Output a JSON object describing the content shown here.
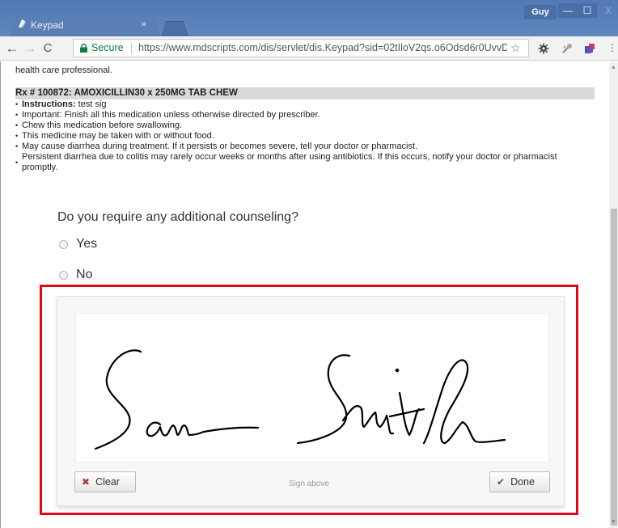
{
  "browser": {
    "tab_title": "Keypad",
    "tab_close": "×",
    "profile": "Guy",
    "window_minimize": "—",
    "window_maximize": "☐",
    "window_close": "X",
    "secure_label": "Secure",
    "url": "https://www.mdscripts.com/dis/servlet/dis.Keypad?sid=02tIloV2qs.o6Odsd6r0UvvD",
    "back_icon": "←",
    "forward_icon": "→",
    "reload_icon": "C",
    "star_icon": "☆"
  },
  "page": {
    "hcp_text": "health care professional.",
    "rx_header": "Rx # 100872: AMOXICILLIN30 x 250MG TAB CHEW",
    "instructions_label": "Instructions:",
    "instructions_value": " test sig",
    "notes": [
      "Important: Finish all this medication unless otherwise directed by prescriber.",
      "Chew this medication before swallowing.",
      "This medicine may be taken with or without food.",
      "May cause diarrhea during treatment. If it persists or becomes severe, tell your doctor or pharmacist.",
      "Persistent diarrhea due to colitis may rarely occur weeks or months after using antibiotics. If this occurs, notify your doctor or pharmacist promptly."
    ],
    "question": "Do you require any additional counseling?",
    "options": [
      "Yes",
      "No"
    ]
  },
  "signature_pad": {
    "clear_label": "Clear",
    "done_label": "Done",
    "hint": "Sign above",
    "clear_icon": "✖",
    "done_icon": "✔",
    "signature_name": "Sam Smith"
  },
  "colors": {
    "highlight_border": "#e30613",
    "secure_green": "#0b8043",
    "titlebar_blue": "#5279b4"
  }
}
